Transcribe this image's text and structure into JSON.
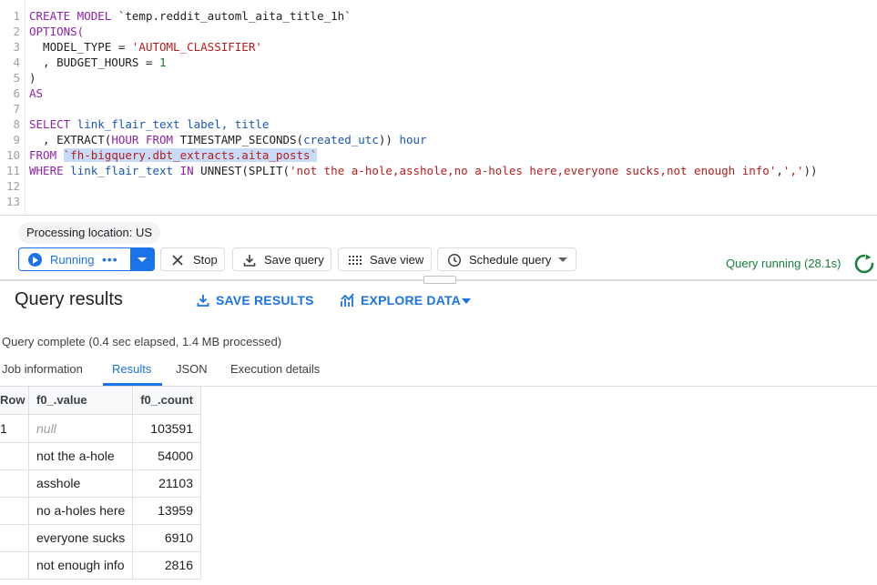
{
  "editor": {
    "lines": [
      {
        "n": "1"
      },
      {
        "n": "2"
      },
      {
        "n": "3"
      },
      {
        "n": "4"
      },
      {
        "n": "5"
      },
      {
        "n": "6"
      },
      {
        "n": "7"
      },
      {
        "n": "8"
      },
      {
        "n": "9"
      },
      {
        "n": "10"
      },
      {
        "n": "11"
      },
      {
        "n": "12"
      },
      {
        "n": "13"
      }
    ],
    "code": {
      "l1a": "CREATE MODEL",
      "l1b": " `temp.reddit_automl_aita_title_1h`",
      "l2": "OPTIONS(",
      "l3a": "  MODEL_TYPE = ",
      "l3b": "'AUTOML_CLASSIFIER'",
      "l4a": "  , BUDGET_HOURS = ",
      "l4b": "1",
      "l5": ")",
      "l6": "AS",
      "l8a": "SELECT",
      "l8b": " link_flair_text label, title",
      "l9a": "  , ",
      "l9b": "EXTRACT",
      "l9c": "(",
      "l9d": "HOUR",
      "l9e": " ",
      "l9f": "FROM",
      "l9g": " ",
      "l9h": "TIMESTAMP_SECONDS",
      "l9i": "(",
      "l9j": "created_utc",
      "l9k": ")) ",
      "l9l": "hour",
      "l10a": "FROM",
      "l10b": " ",
      "l10c": "`fh-bigquery.dbt_extracts.aita_posts`",
      "l11a": "WHERE",
      "l11b": " link_flair_text ",
      "l11c": "IN",
      "l11d": " ",
      "l11e": "UNNEST",
      "l11f": "(",
      "l11g": "SPLIT",
      "l11h": "(",
      "l11i": "'not the a-hole,asshole,no a-holes here,everyone sucks,not enough info'",
      "l11j": ",",
      "l11k": "','",
      "l11l": "))"
    }
  },
  "toolbar": {
    "location_chip": "Processing location: US",
    "run_label": "Running",
    "run_dots": "•••",
    "stop_label": "Stop",
    "save_query_label": "Save query",
    "save_view_label": "Save view",
    "schedule_label": "Schedule query",
    "status_text": "Query running (28.1s)"
  },
  "results": {
    "title": "Query results",
    "save_results": "SAVE RESULTS",
    "explore_data": "EXPLORE DATA",
    "complete_text": "Query complete (0.4 sec elapsed, 1.4 MB processed)",
    "tabs": [
      "Job information",
      "Results",
      "JSON",
      "Execution details"
    ],
    "columns": [
      "Row",
      "f0_.value",
      "f0_.count"
    ],
    "rows": [
      {
        "row": "1",
        "value": "null",
        "count": "103591"
      },
      {
        "row": "",
        "value": "not the a-hole",
        "count": "54000"
      },
      {
        "row": "",
        "value": "asshole",
        "count": "21103"
      },
      {
        "row": "",
        "value": "no a-holes here",
        "count": "13959"
      },
      {
        "row": "",
        "value": "everyone sucks",
        "count": "6910"
      },
      {
        "row": "",
        "value": "not enough info",
        "count": "2816"
      }
    ]
  },
  "colors": {
    "accent": "#1a73e8",
    "success": "#188038"
  },
  "icons": [
    "play-icon",
    "stop-icon",
    "save-icon",
    "grid-icon",
    "clock-icon",
    "chevron-down-icon",
    "download-icon",
    "chart-icon",
    "refresh-icon"
  ]
}
